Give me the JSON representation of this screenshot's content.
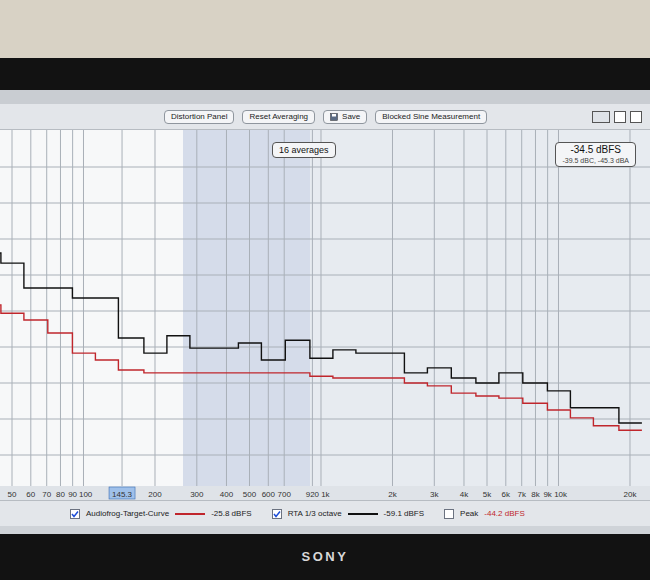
{
  "toolbar": {
    "buttons": [
      {
        "label": "Distortion Panel",
        "icon": false
      },
      {
        "label": "Reset Averaging",
        "icon": false
      },
      {
        "label": "Save",
        "icon": true
      },
      {
        "label": "Blocked Sine Measurement",
        "icon": false
      }
    ]
  },
  "averages": "16 averages",
  "level_display": {
    "main": "-34.5 dBFS",
    "sub": "-39.5 dBC, -45.3 dBA"
  },
  "chart": {
    "x_ticks": [
      {
        "label": "50",
        "hz": 50,
        "selected": false
      },
      {
        "label": "60",
        "hz": 60,
        "selected": false
      },
      {
        "label": "70",
        "hz": 70,
        "selected": false
      },
      {
        "label": "80",
        "hz": 80,
        "selected": false
      },
      {
        "label": "90",
        "hz": 90,
        "selected": false
      },
      {
        "label": "100",
        "hz": 100,
        "selected": false
      },
      {
        "label": "145.3",
        "hz": 145.3,
        "selected": true
      },
      {
        "label": "200",
        "hz": 200,
        "selected": false
      },
      {
        "label": "300",
        "hz": 300,
        "selected": false
      },
      {
        "label": "400",
        "hz": 400,
        "selected": false
      },
      {
        "label": "500",
        "hz": 500,
        "selected": false
      },
      {
        "label": "600",
        "hz": 600,
        "selected": false
      },
      {
        "label": "700",
        "hz": 700,
        "selected": false
      },
      {
        "label": "920",
        "hz": 920,
        "selected": false
      },
      {
        "label": "1k",
        "hz": 1000,
        "selected": false
      },
      {
        "label": "2k",
        "hz": 2000,
        "selected": false
      },
      {
        "label": "3k",
        "hz": 3000,
        "selected": false
      },
      {
        "label": "4k",
        "hz": 4000,
        "selected": false
      },
      {
        "label": "5k",
        "hz": 5000,
        "selected": false
      },
      {
        "label": "6k",
        "hz": 6000,
        "selected": false
      },
      {
        "label": "7k",
        "hz": 7000,
        "selected": false
      },
      {
        "label": "8k",
        "hz": 8000,
        "selected": false
      },
      {
        "label": "9k",
        "hz": 9000,
        "selected": false
      },
      {
        "label": "10k",
        "hz": 10000,
        "selected": false
      },
      {
        "label": "20k",
        "hz": 20000,
        "selected": false
      }
    ],
    "bands_hz": [
      40,
      50,
      63,
      80,
      100,
      125,
      160,
      200,
      250,
      315,
      400,
      500,
      630,
      800,
      1000,
      1250,
      1600,
      2000,
      2500,
      3150,
      4000,
      5000,
      6300,
      8000,
      10000,
      12500,
      16000,
      20000
    ],
    "series": [
      {
        "name": "Audiofrog-Target-Curve",
        "checked": true,
        "reading": "-25.8 dBFS",
        "color": "#c0262c",
        "values": [
          -48.3,
          -50.6,
          -52.5,
          -56.1,
          -61.7,
          -63.6,
          -66.4,
          -67.2,
          -67.2,
          -67.2,
          -67.2,
          -67.2,
          -67.2,
          -67.2,
          -68.1,
          -68.6,
          -68.6,
          -68.6,
          -70.0,
          -70.8,
          -72.8,
          -73.6,
          -74.2,
          -75.6,
          -77.5,
          -79.7,
          -81.9,
          -83.1
        ]
      },
      {
        "name": "RTA 1/3 octave",
        "checked": true,
        "reading": "-59.1 dBFS",
        "color": "#111111",
        "values": [
          -33.9,
          -36.7,
          -43.6,
          -43.6,
          -46.4,
          -46.4,
          -57.5,
          -61.7,
          -56.9,
          -60.3,
          -60.3,
          -58.9,
          -63.6,
          -58.1,
          -63.1,
          -60.8,
          -61.7,
          -61.7,
          -67.2,
          -65.8,
          -68.6,
          -70.0,
          -67.2,
          -70.0,
          -72.2,
          -76.9,
          -76.9,
          -81.1
        ]
      },
      {
        "name": "Peak",
        "checked": false,
        "reading": "-44.2 dBFS",
        "color": "#c0262c",
        "values": []
      }
    ]
  },
  "brand": "SONY"
}
